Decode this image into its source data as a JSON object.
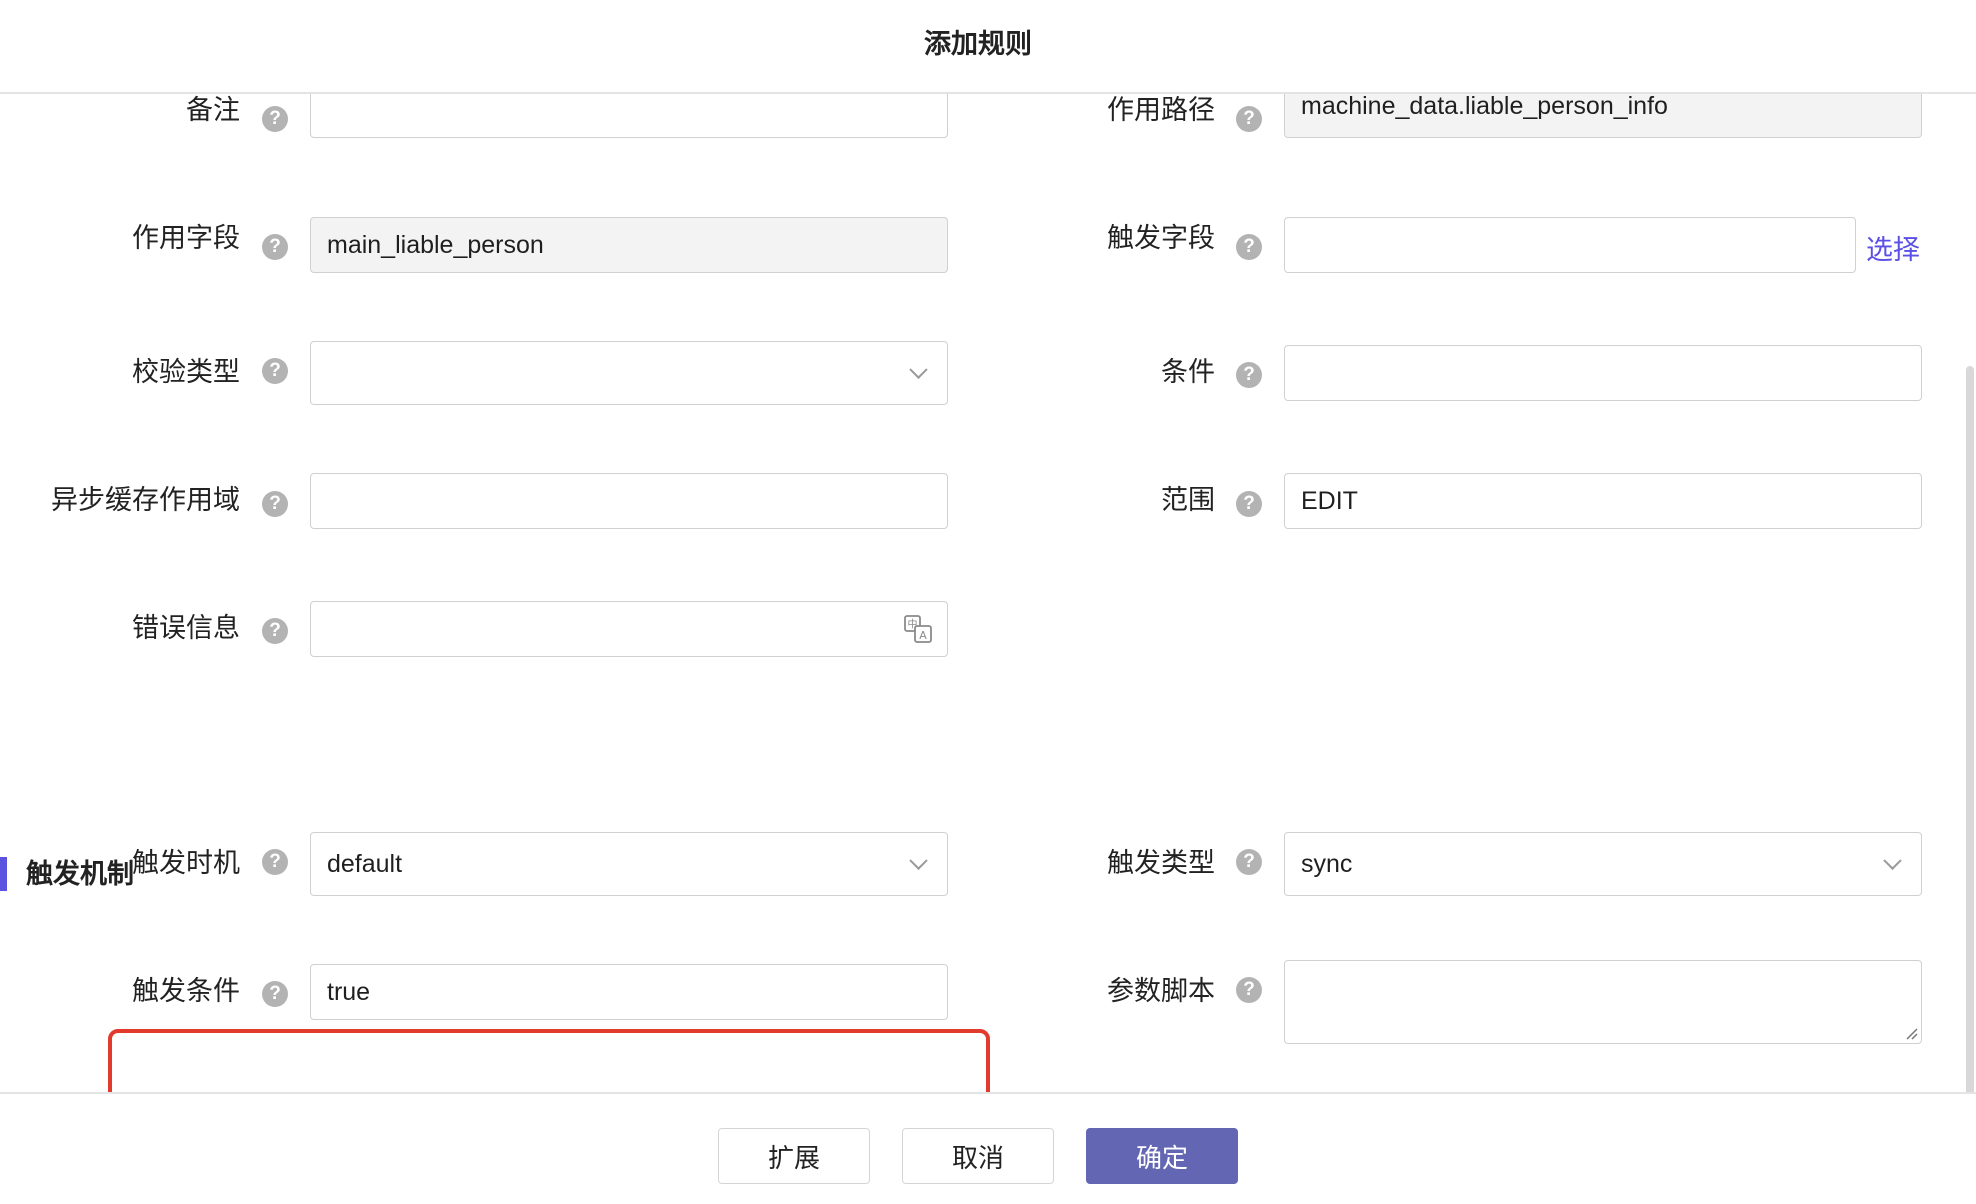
{
  "dialog": {
    "title": "添加规则"
  },
  "form": {
    "remark": {
      "label": "备注",
      "value": ""
    },
    "path": {
      "label": "作用路径",
      "value": "machine_data.liable_person_info"
    },
    "field": {
      "label": "作用字段",
      "value": "main_liable_person"
    },
    "trigger_field": {
      "label": "触发字段",
      "value": "",
      "link": "选择"
    },
    "validation_type": {
      "label": "校验类型",
      "value": ""
    },
    "condition": {
      "label": "条件",
      "value": ""
    },
    "async_cache_scope": {
      "label": "异步缓存作用域",
      "value": ""
    },
    "scope": {
      "label": "范围",
      "value": "EDIT"
    },
    "error_message": {
      "label": "错误信息",
      "value": ""
    }
  },
  "trigger_section": {
    "title": "触发机制",
    "timing": {
      "label": "触发时机",
      "value": "default"
    },
    "type": {
      "label": "触发类型",
      "value": "sync"
    },
    "condition": {
      "label": "触发条件",
      "value": "true"
    },
    "param_script": {
      "label": "参数脚本",
      "value": ""
    }
  },
  "help_glyph": "?",
  "footer": {
    "extend": "扩展",
    "cancel": "取消",
    "confirm": "确定"
  },
  "colors": {
    "accent": "#5b52e0",
    "primary_button": "#6367b3",
    "highlight": "#e23b2e",
    "link": "#5b4fe6"
  }
}
